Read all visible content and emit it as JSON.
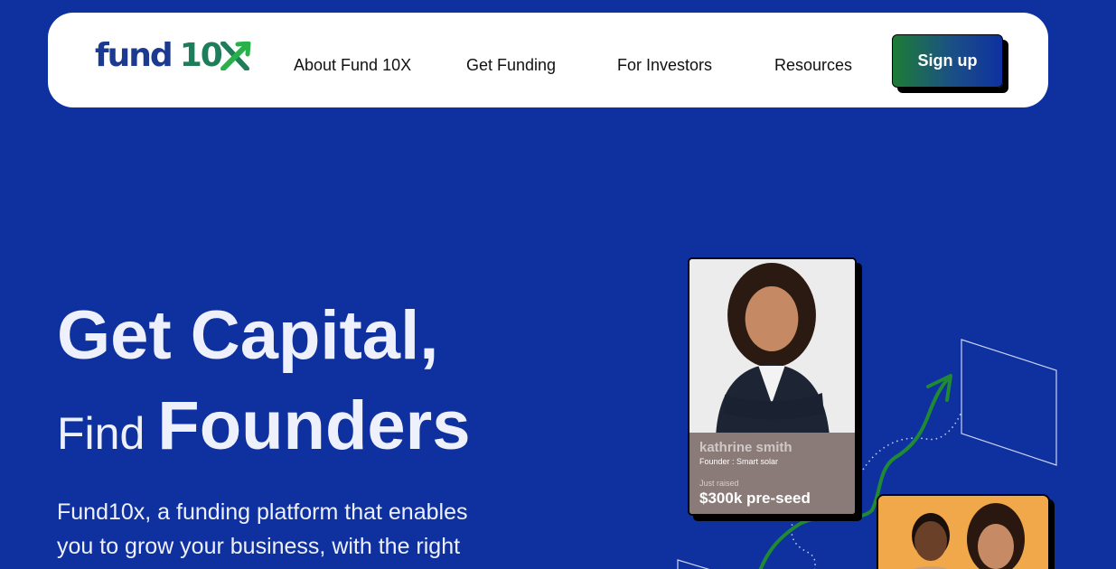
{
  "brand": {
    "logo_word1": "fund",
    "logo_word2": "10"
  },
  "nav": {
    "links": [
      "About Fund 10X",
      "Get Funding",
      "For Investors",
      "Resources"
    ],
    "signup_label": "Sign up"
  },
  "hero": {
    "line1": "Get Capital,",
    "line2_small": "Find",
    "line2_big": "Founders",
    "description": "Fund10x, a funding platform that enables you to grow your business, with the right"
  },
  "founder_card": {
    "name": "kathrine smith",
    "role": "Founder : Smart solar",
    "raised_label": "Just raised",
    "raised_value": "$300k pre-seed"
  },
  "colors": {
    "background": "#0f31a0",
    "logo_blue": "#1c3a8f",
    "logo_green": "#1e7d5a",
    "arrow_green": "#1f8a33",
    "button_gradient_start": "#1d7c36"
  },
  "icons": {
    "logo_mark": "growth-arrow-x-icon"
  }
}
